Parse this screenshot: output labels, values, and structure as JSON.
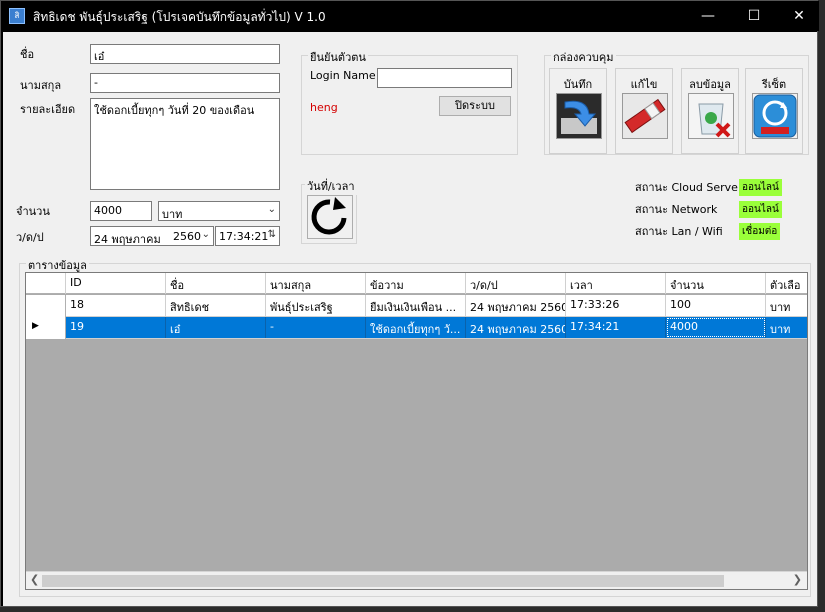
{
  "window": {
    "title": "สิทธิเดช พันธุ์ประเสริฐ (โปรเจคบันทึกข้อมูลทั่วไป) V 1.0",
    "icon_text": "สิ",
    "minimize_icon": "minimize-icon",
    "maximize_icon": "maximize-icon",
    "close_icon": "close-icon"
  },
  "form": {
    "name_label": "ชื่อ",
    "name_value": "เอ๋",
    "lastname_label": "นามสกุล",
    "lastname_value": "-",
    "detail_label": "รายละเอียด",
    "detail_value": "ใช้ดอกเบี้ยทุกๆ วันที่ 20 ของเดือน",
    "amount_label": "จำนวน",
    "amount_value": "4000",
    "unit_value": "บาท",
    "date_label": "ว/ด/ป",
    "date_day": "24",
    "date_month": "พฤษภาคม",
    "date_year": "2560",
    "time_value": "17:34:21"
  },
  "auth": {
    "group_title": "ยืนยันตัวตน",
    "login_label": "Login Name",
    "login_value": "",
    "user_text": "heng",
    "close_system_label": "ปิดระบบ"
  },
  "control": {
    "group_title": "กล่องควบคุม",
    "tools": [
      {
        "label": "บันทึก",
        "icon": "save-icon"
      },
      {
        "label": "แก้ไข",
        "icon": "edit-icon"
      },
      {
        "label": "ลบข้อมูล",
        "icon": "delete-icon"
      },
      {
        "label": "รีเซ็ต",
        "icon": "reset-icon"
      }
    ]
  },
  "datetime": {
    "group_title": "วันที่/เวลา",
    "refresh_icon": "refresh-icon"
  },
  "status": {
    "rows": [
      {
        "label": "สถานะ Cloud Server",
        "value": "ออนไลน์"
      },
      {
        "label": "สถานะ Network",
        "value": "ออนไลน์"
      },
      {
        "label": "สถานะ Lan / Wifi",
        "value": "เชื่อมต่อ"
      }
    ],
    "badge_color": "#9aff3a"
  },
  "table": {
    "group_title": "ตารางข้อมูล",
    "columns": [
      "ID",
      "ชื่อ",
      "นามสกุล",
      "ข้อวาม",
      "ว/ด/ป",
      "เวลา",
      "จำนวน",
      "ตัวเลือ"
    ],
    "rows": [
      [
        "18",
        "สิทธิเดช",
        "พันธุ์ประเสริฐ",
        "ยืมเงินเงินเพือน ...",
        "24 พฤษภาคม 2560",
        "17:33:26",
        "100",
        "บาท"
      ],
      [
        "19",
        "เอ๋",
        "-",
        "ใช้ดอกเบี้ยทุกๆ วั...",
        "24 พฤษภาคม 2560",
        "17:34:21",
        "4000",
        "บาท"
      ]
    ],
    "selected_row": 1,
    "selection_color": "#0078d7"
  }
}
